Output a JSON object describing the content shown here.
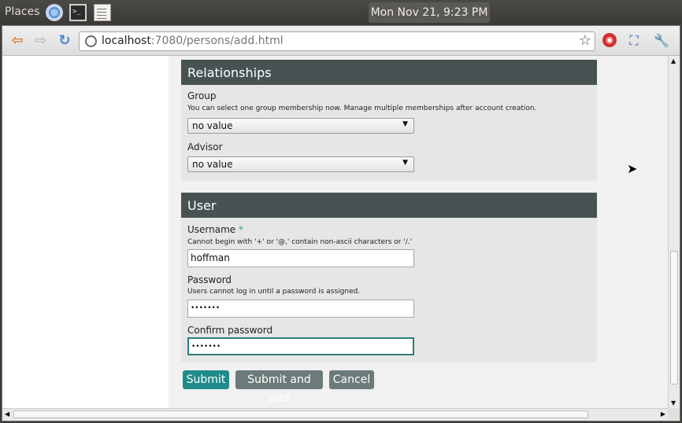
{
  "panel": {
    "places_label": "Places",
    "clock": "Mon Nov 21,  9:23 PM",
    "launchers": [
      "chrome-icon",
      "terminal-icon",
      "text-editor-icon"
    ]
  },
  "browser": {
    "url_host": "localhost",
    "url_rest": ":7080/persons/add.html",
    "icons": [
      "back-arrow-icon",
      "forward-arrow-icon",
      "reload-icon",
      "globe-icon",
      "bookmark-star-icon",
      "extension-red-icon",
      "window-maximize-icon",
      "wrench-icon"
    ]
  },
  "form": {
    "relationships": {
      "title": "Relationships",
      "group_label": "Group",
      "group_help": "You can select one group membership now. Manage multiple memberships after account creation.",
      "group_value": "no value",
      "advisor_label": "Advisor",
      "advisor_value": "no value"
    },
    "user": {
      "title": "User",
      "username_label": "Username",
      "required_mark": "*",
      "username_help": "Cannot begin with '+' or '@,' contain non-ascii characters or '/.'",
      "username_value": "hoffman",
      "password_label": "Password",
      "password_help": "Users cannot log in until a password is assigned.",
      "password_value": "•••••••",
      "confirm_label": "Confirm password",
      "confirm_value": "•••••••"
    },
    "buttons": {
      "submit": "Submit",
      "submit_add": "Submit and add",
      "cancel": "Cancel"
    }
  },
  "colors": {
    "section_header": "#475352",
    "primary_button": "#1f8c8b",
    "secondary_button": "#6c7b79"
  }
}
